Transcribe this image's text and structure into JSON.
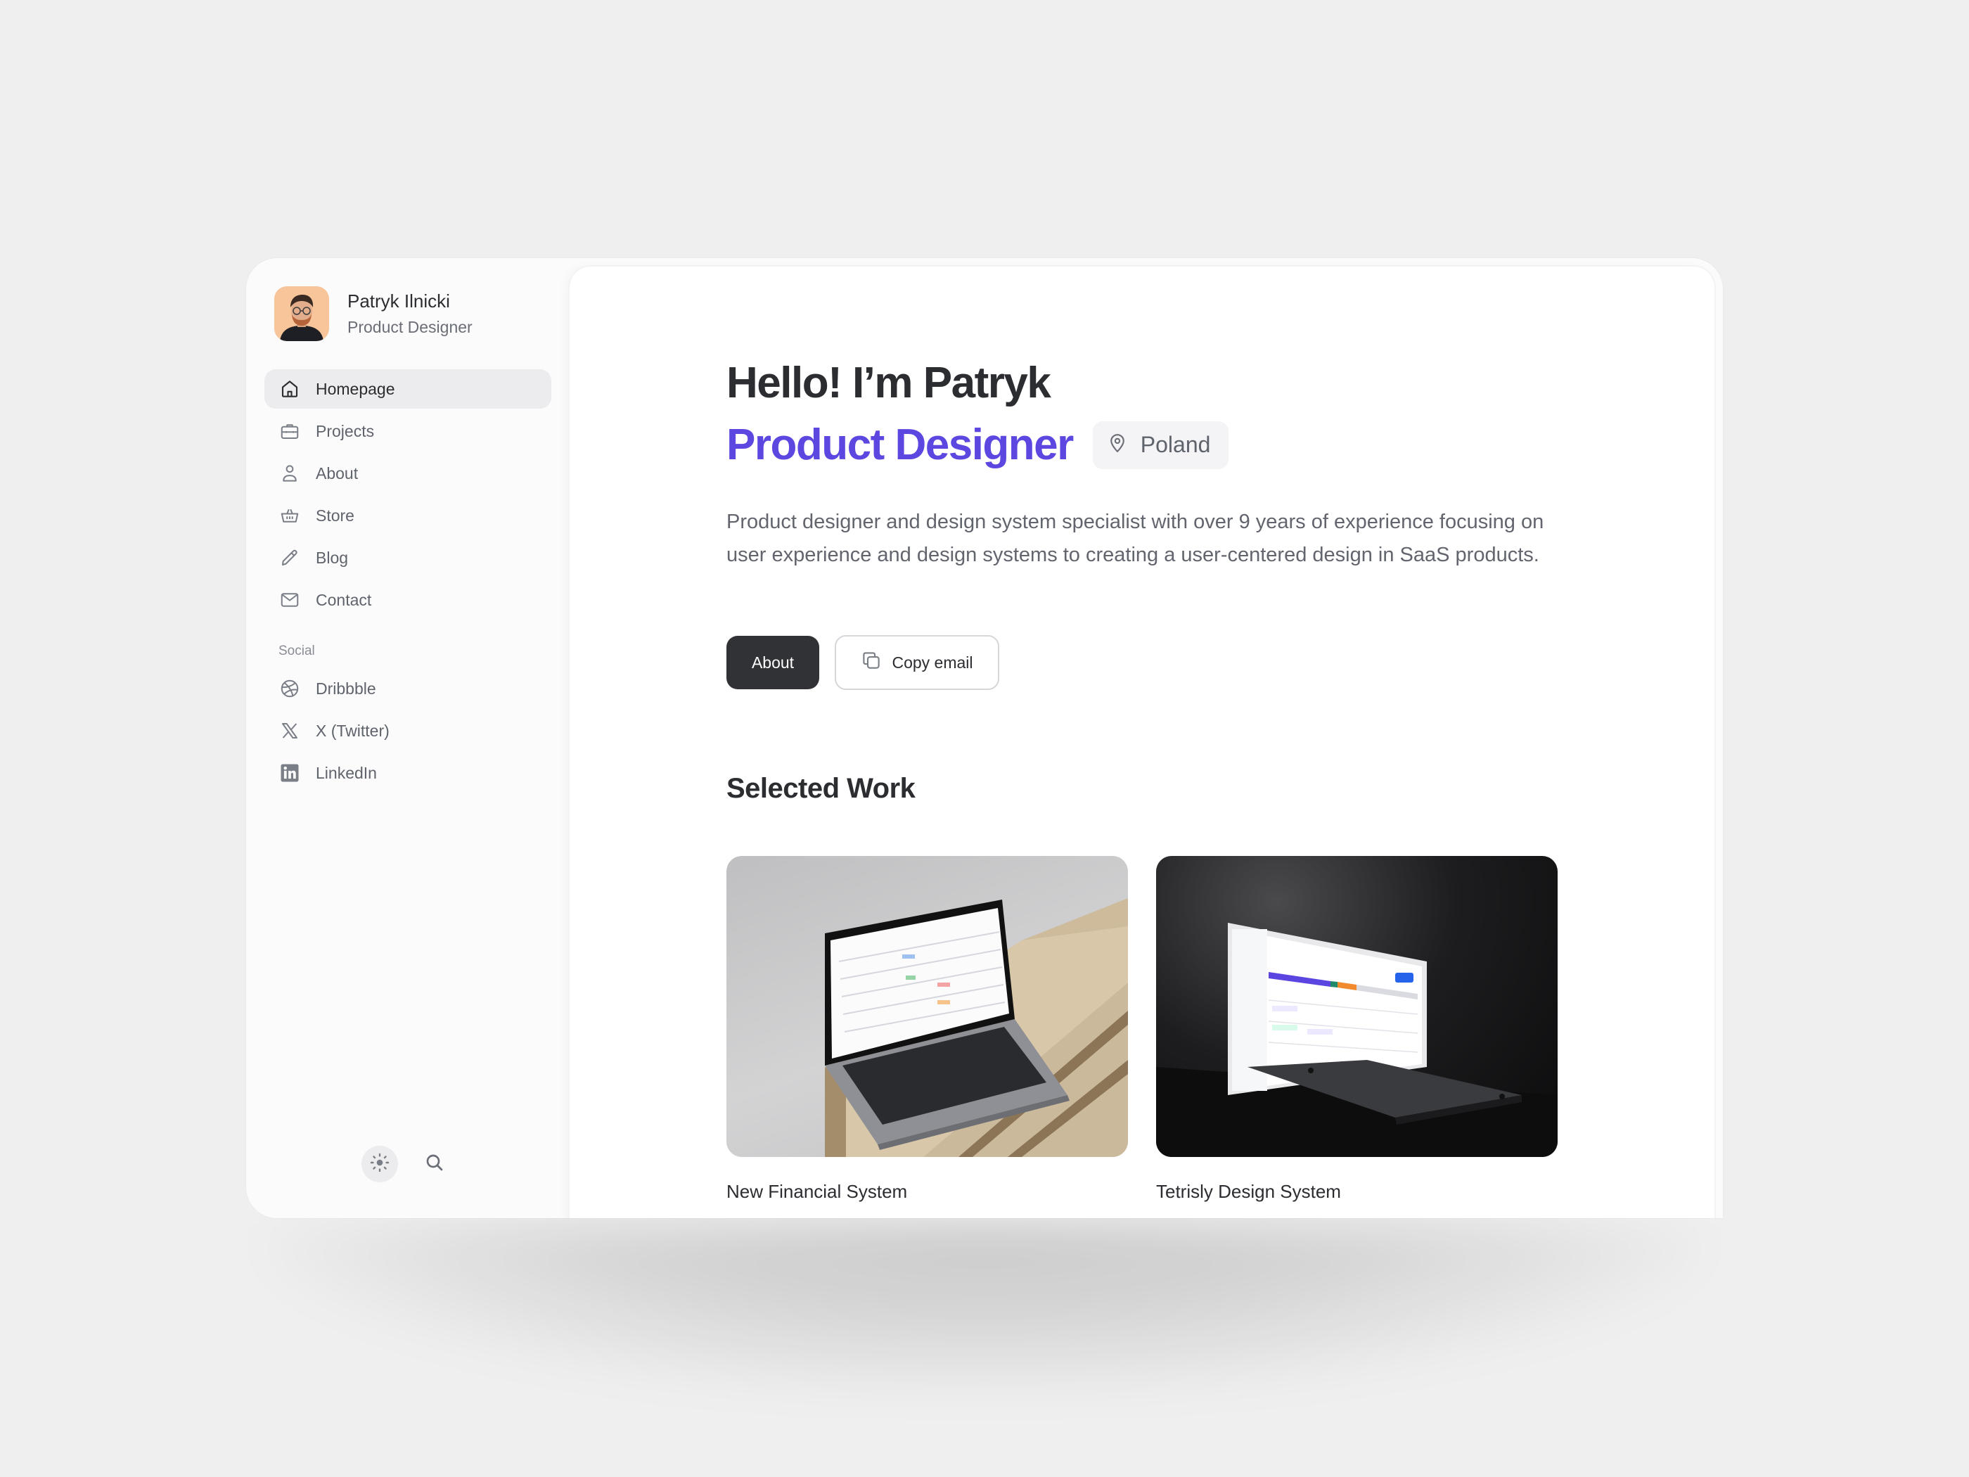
{
  "profile": {
    "name": "Patryk Ilnicki",
    "role": "Product Designer",
    "avatar_bg": "#F8C59B"
  },
  "nav": {
    "items": [
      {
        "label": "Homepage",
        "icon": "home-icon",
        "active": true
      },
      {
        "label": "Projects",
        "icon": "briefcase-icon",
        "active": false
      },
      {
        "label": "About",
        "icon": "user-icon",
        "active": false
      },
      {
        "label": "Store",
        "icon": "basket-icon",
        "active": false
      },
      {
        "label": "Blog",
        "icon": "pencil-icon",
        "active": false
      },
      {
        "label": "Contact",
        "icon": "mail-icon",
        "active": false
      }
    ],
    "social_label": "Social",
    "social": [
      {
        "label": "Dribbble",
        "icon": "dribbble-icon"
      },
      {
        "label": "X (Twitter)",
        "icon": "x-twitter-icon"
      },
      {
        "label": "LinkedIn",
        "icon": "linkedin-icon"
      }
    ]
  },
  "tools": {
    "theme_icon": "sun-icon",
    "search_icon": "search-icon"
  },
  "hero": {
    "title": "Hello! I’m Patryk",
    "subtitle": "Product Designer",
    "accent_color": "#5C47E0",
    "location": "Poland",
    "location_icon": "map-pin-icon",
    "bio": "Product designer and design system specialist with over 9 years of experience focusing on user experience and design systems to creating a user-centered design in SaaS products.",
    "primary_button": "About",
    "secondary_button": "Copy email",
    "secondary_icon": "copy-icon"
  },
  "work": {
    "title": "Selected Work",
    "items": [
      {
        "title": "New Financial System",
        "image": "laptop on wooden pallet showing table dashboard"
      },
      {
        "title": "Tetrisly Design System",
        "image": "laptop in dark scene showing calendar dashboard"
      }
    ]
  }
}
